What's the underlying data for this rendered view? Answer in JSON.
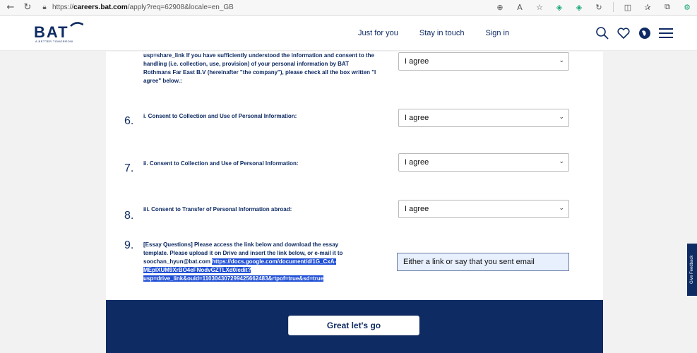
{
  "browser": {
    "url_prefix": "https://",
    "url_host": "careers.bat.com",
    "url_path": "/apply?req=62908&locale=en_GB"
  },
  "header": {
    "logo": "BAT",
    "logo_tagline": "A BETTER TOMORROW",
    "nav": [
      "Just for you",
      "Stay in touch",
      "Sign in"
    ]
  },
  "form": {
    "q5": {
      "text": "usp=share_link If you have sufficiently understood the information and consent to the handling (i.e. collection, use, provision) of your personal information by BAT Rothmans Far East B.V (hereinafter \"the company\"), please check all the box written \"I agree\" below.:",
      "selected": "I agree"
    },
    "q6": {
      "num": "6.",
      "text": "i. Consent to Collection and Use of Personal Information:",
      "selected": "I agree"
    },
    "q7": {
      "num": "7.",
      "text": "ii. Consent to Collection and Use of Personal Information:",
      "selected": "I agree"
    },
    "q8": {
      "num": "8.",
      "text": "iii. Consent to Transfer of Personal Information abroad:",
      "selected": "I agree"
    },
    "q9": {
      "num": "9.",
      "line1": "[Essay Questions] Please access the link below and download the essay",
      "line2": "template. Please upload it on Drive and insert the link below, or e-mail it to",
      "email": "soochan_hyun@bat.com",
      "link1": "https://docs.google.com/document/d/1G_CxA-",
      "link2": "MEplXUM9XrBO4eFNodvGZTLXd0/edit?",
      "link3": "usp=drive_link&ouid=110304307299425662483&rtpof=true&sd=true",
      "placeholder": "Either a link or say that you sent email"
    }
  },
  "footer": {
    "button": "Great let's go"
  },
  "feedback": {
    "label": "Give Feedback"
  },
  "colors": {
    "brand": "#0e2b63",
    "highlight": "#1f4fd6",
    "input_bg": "#e8f0fe"
  }
}
